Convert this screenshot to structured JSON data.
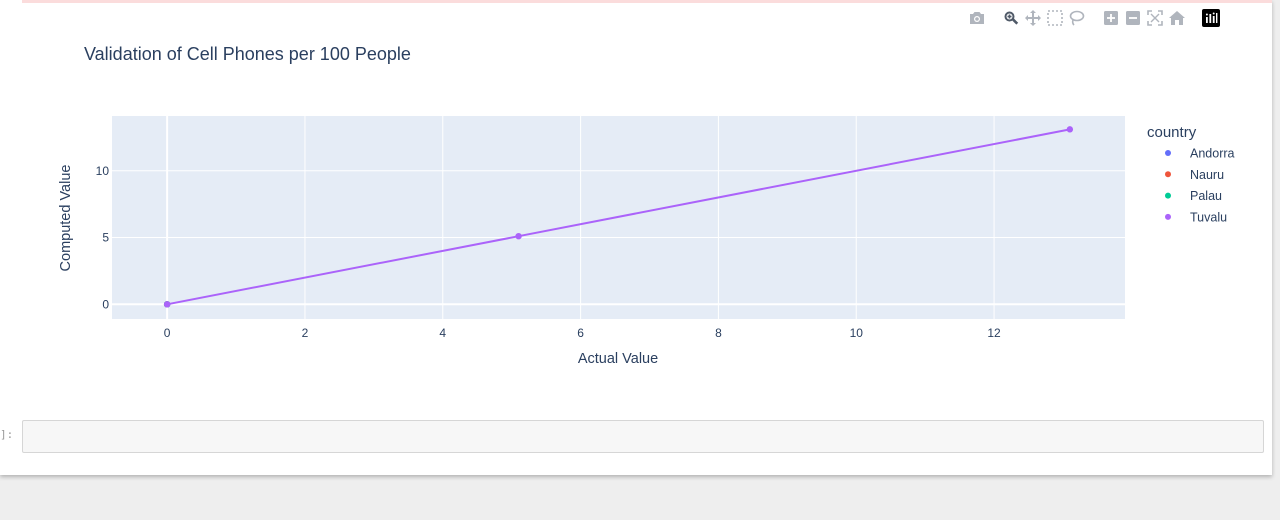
{
  "modebar": {
    "icons": [
      "camera-icon",
      "zoom-icon",
      "pan-icon",
      "box-select-icon",
      "lasso-icon",
      "zoom-in-icon",
      "zoom-out-icon",
      "autoscale-icon",
      "home-icon",
      "plotly-logo-icon"
    ]
  },
  "cell": {
    "prompt": "]:"
  },
  "chart_data": {
    "type": "line",
    "title": "Validation of Cell Phones per 100 People",
    "xlabel": "Actual Value",
    "ylabel": "Computed Value",
    "xlim": [
      -0.8,
      13.9
    ],
    "ylim": [
      -1.1,
      14.1
    ],
    "xticks": [
      0,
      2,
      4,
      6,
      8,
      10,
      12
    ],
    "yticks": [
      0,
      5,
      10
    ],
    "grid": true,
    "plot_bg": "#e5ecf6",
    "legend": {
      "title": "country",
      "placement": "right"
    },
    "series": [
      {
        "name": "Andorra",
        "color": "#636efa",
        "x": [
          0
        ],
        "y": [
          0
        ]
      },
      {
        "name": "Nauru",
        "color": "#ef553b",
        "x": [
          0
        ],
        "y": [
          0
        ]
      },
      {
        "name": "Palau",
        "color": "#00cc96",
        "x": [
          0
        ],
        "y": [
          0
        ]
      },
      {
        "name": "Tuvalu",
        "color": "#ab63fa",
        "x": [
          0,
          5.1,
          13.1
        ],
        "y": [
          0,
          5.1,
          13.1
        ]
      }
    ]
  }
}
